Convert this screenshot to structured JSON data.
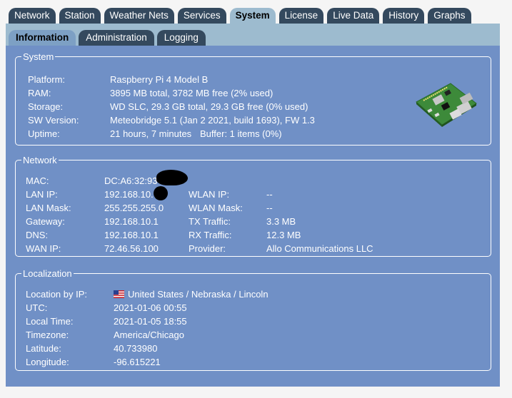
{
  "tabs": [
    "Network",
    "Station",
    "Weather Nets",
    "Services",
    "System",
    "License",
    "Live Data",
    "History",
    "Graphs"
  ],
  "active_tab": "System",
  "subtabs": [
    "Information",
    "Administration",
    "Logging"
  ],
  "active_subtab": "Information",
  "system": {
    "legend": "System",
    "platform_label": "Platform:",
    "platform_value": "Raspberry Pi 4 Model B",
    "ram_label": "RAM:",
    "ram_value": "3895 MB total, 3782 MB free (2% used)",
    "storage_label": "Storage:",
    "storage_value": "WD SLC, 29.3 GB total, 29.3 GB free (0% used)",
    "sw_label": "SW Version:",
    "sw_value": "Meteobridge 5.1 (Jan 2 2021, build 1693), FW 1.3",
    "uptime_label": "Uptime:",
    "uptime_value": "21 hours, 7 minutes",
    "buffer_value": "Buffer: 1 items (0%)",
    "device_image": "raspberry-pi-board-icon"
  },
  "network": {
    "legend": "Network",
    "mac_label": "MAC:",
    "mac_value": "DC:A6:32:93",
    "lanip_label": "LAN IP:",
    "lanip_value": "192.168.10.",
    "lanmask_label": "LAN Mask:",
    "lanmask_value": "255.255.255.0",
    "gateway_label": "Gateway:",
    "gateway_value": "192.168.10.1",
    "dns_label": "DNS:",
    "dns_value": "192.168.10.1",
    "wanip_label": "WAN IP:",
    "wanip_value": "72.46.56.100",
    "wlanip_label": "WLAN IP:",
    "wlanip_value": "--",
    "wlanmask_label": "WLAN Mask:",
    "wlanmask_value": "--",
    "tx_label": "TX Traffic:",
    "tx_value": "3.3 MB",
    "rx_label": "RX Traffic:",
    "rx_value": "12.3 MB",
    "provider_label": "Provider:",
    "provider_value": "Allo Communications LLC"
  },
  "localization": {
    "legend": "Localization",
    "location_label": "Location by IP:",
    "location_value": "United States / Nebraska / Lincoln",
    "flag_icon": "us-flag-icon",
    "utc_label": "UTC:",
    "utc_value": "2021-01-06 00:55",
    "localtime_label": "Local Time:",
    "localtime_value": "2021-01-05 18:55",
    "timezone_label": "Timezone:",
    "timezone_value": "America/Chicago",
    "latitude_label": "Latitude:",
    "latitude_value": "40.733980",
    "longitude_label": "Longitude:",
    "longitude_value": "-96.615221"
  },
  "colors": {
    "tab_bg": "#34495e",
    "active_tab_bg": "#9dbbcf",
    "panel_bg": "#7090c6"
  }
}
